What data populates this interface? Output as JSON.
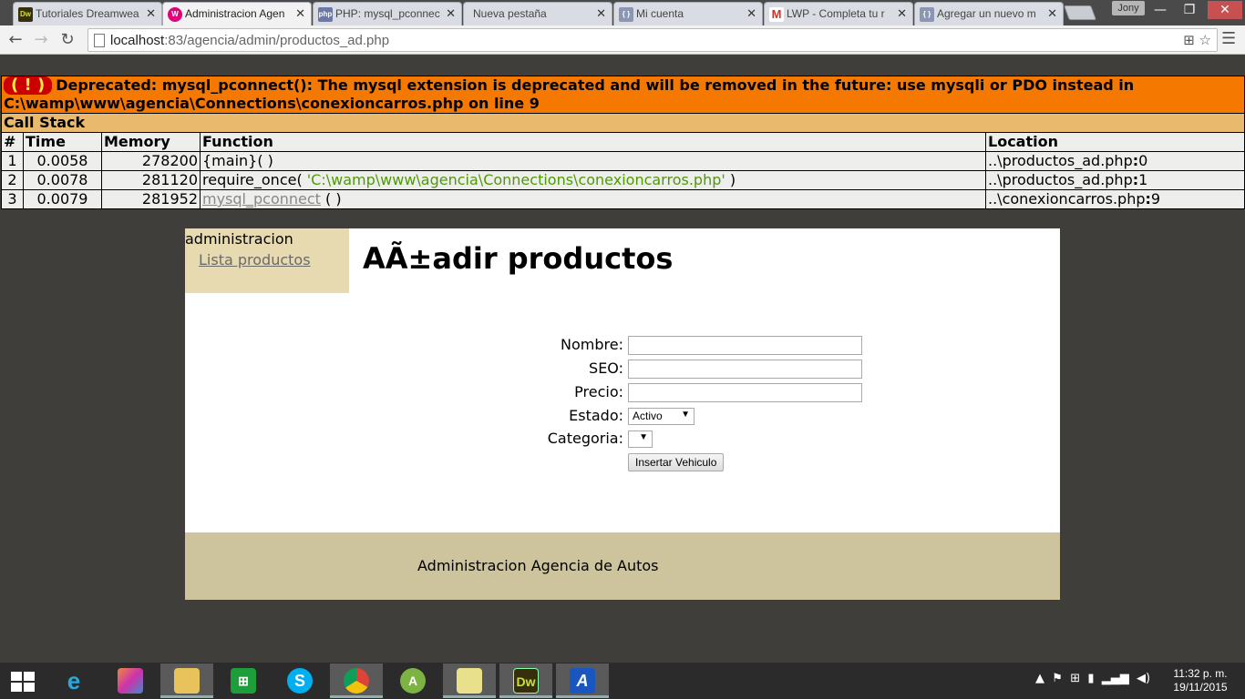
{
  "browser": {
    "tabs": [
      {
        "title": "Tutoriales Dreamwea",
        "favicon": "dreamweaver-icon"
      },
      {
        "title": "Administracion Agen",
        "favicon": "wamp-icon",
        "active": true
      },
      {
        "title": "PHP: mysql_pconnec",
        "favicon": "php-icon"
      },
      {
        "title": "Nueva pestaña",
        "favicon": ""
      },
      {
        "title": "Mi cuenta",
        "favicon": "doc-icon"
      },
      {
        "title": "LWP - Completa tu r",
        "favicon": "gmail-icon"
      },
      {
        "title": "Agregar un nuevo m",
        "favicon": "doc-icon"
      }
    ],
    "user": "Jony",
    "url_host": "localhost",
    "url_rest": ":83/agencia/admin/productos_ad.php"
  },
  "xdebug": {
    "bang": "( ! )",
    "message": "Deprecated: mysql_pconnect(): The mysql extension is deprecated and will be removed in the future: use mysqli or PDO instead in C:\\wamp\\www\\agencia\\Connections\\conexioncarros.php on line 9",
    "call_stack_label": "Call Stack",
    "columns": [
      "#",
      "Time",
      "Memory",
      "Function",
      "Location"
    ],
    "rows": [
      {
        "n": "1",
        "time": "0.0058",
        "memory": "278200",
        "func": "{main}( )",
        "arg": "",
        "loc_file": "..\\productos_ad.php",
        "loc_line": "0"
      },
      {
        "n": "2",
        "time": "0.0078",
        "memory": "281120",
        "func": "require_once( ",
        "arg": "'C:\\wamp\\www\\agencia\\Connections\\conexioncarros.php'",
        "loc_file": "..\\productos_ad.php",
        "loc_line": "1"
      },
      {
        "n": "3",
        "time": "0.0079",
        "memory": "281952",
        "func": "mysql_pconnect",
        "arg": "",
        "loc_file": "..\\conexioncarros.php",
        "loc_line": "9"
      }
    ]
  },
  "page": {
    "sidebar_heading": "administracion",
    "sidebar_link": "Lista productos",
    "title": "AÃ±adir productos",
    "form": {
      "nombre_label": "Nombre:",
      "seo_label": "SEO:",
      "precio_label": "Precio:",
      "estado_label": "Estado:",
      "estado_value": "Activo",
      "categoria_label": "Categoria:",
      "submit_label": "Insertar Vehiculo"
    },
    "footer": "Administracion Agencia de Autos"
  },
  "taskbar": {
    "time": "11:32 p. m.",
    "date": "19/11/2015"
  }
}
